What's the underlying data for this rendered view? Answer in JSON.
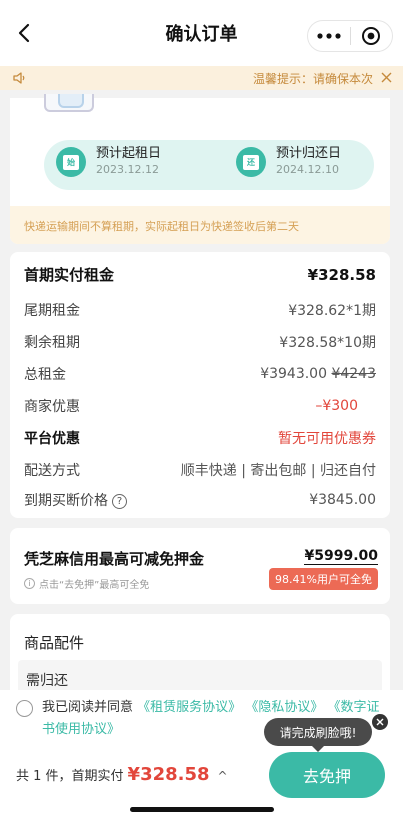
{
  "navbar": {
    "title": "确认订单"
  },
  "notice": {
    "text": "温馨提示：请确保本次"
  },
  "rental_dates": {
    "start_label": "预计起租日",
    "start_value": "2023.12.12",
    "start_icon_char": "始",
    "end_label": "预计归还日",
    "end_value": "2024.12.10",
    "end_icon_char": "还",
    "shipping_tip": "快递运输期间不算租期，实际起租日为快递签收后第二天"
  },
  "costs": {
    "first_payment": {
      "label": "首期实付租金",
      "value": "¥328.58"
    },
    "last_period": {
      "label": "尾期租金",
      "value": "¥328.62*1期"
    },
    "remaining": {
      "label": "剩余租期",
      "value": "¥328.58*10期"
    },
    "total": {
      "label": "总租金",
      "value": "¥3943.00",
      "original": "¥4243"
    },
    "merchant_discount": {
      "label": "商家优惠",
      "value": "–¥300"
    },
    "platform_discount": {
      "label": "平台优惠",
      "value": "暂无可用优惠券"
    },
    "delivery": {
      "label": "配送方式",
      "value": "顺丰快递 | 寄出包邮 | 归还自付"
    },
    "buyout": {
      "label": "到期买断价格",
      "help": "?",
      "value": "¥3845.00"
    }
  },
  "deposit": {
    "title": "凭芝麻信用最高可减免押金",
    "amount": "¥5999.00",
    "hint": "点击“去免押”最高可全免",
    "hint_icon": "i",
    "badge": "98.41%用户可全免"
  },
  "accessories": {
    "title": "商品配件",
    "item": "需归还"
  },
  "agreement": {
    "prefix": "我已阅读并同意",
    "link1": "《租赁服务协议》",
    "link2": "《隐私协议》",
    "link3": "《数字证书使用协议》"
  },
  "bottom": {
    "summary": "共 1 件，首期实付",
    "price": "¥328.58",
    "caret": "^",
    "button": "去免押"
  },
  "tooltip": {
    "text": "请完成刷脸哦!"
  },
  "colors": {
    "accent": "#3bbaa6",
    "price_red": "#e2463b",
    "notice_bg": "#fbf0dd"
  }
}
